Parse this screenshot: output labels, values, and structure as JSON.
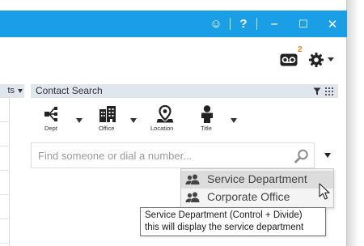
{
  "titlebar": {
    "color": "#1a9ee6",
    "buttons": [
      {
        "name": "feedback-smiley-icon",
        "glyph": "☺"
      },
      {
        "name": "help-icon",
        "glyph": "?"
      },
      {
        "name": "minimize-icon",
        "glyph": "–"
      },
      {
        "name": "maximize-icon",
        "glyph": "☐"
      },
      {
        "name": "close-icon",
        "glyph": "✕"
      }
    ]
  },
  "toolbar": {
    "voicemail_count": "2",
    "voicemail_badge_color": "#e8801a"
  },
  "left_panel": {
    "header_fragment": "ts"
  },
  "contact_search": {
    "title": "Contact Search",
    "filters": [
      {
        "label": "Dept",
        "icon": "org-chart-icon"
      },
      {
        "label": "Office",
        "icon": "building-icon"
      },
      {
        "label": "Location",
        "icon": "location-pin-icon"
      },
      {
        "label": "Title",
        "icon": "person-icon"
      }
    ],
    "search_placeholder": "Find someone or dial a number..."
  },
  "dropdown": {
    "items": [
      {
        "label": "Service Department",
        "selected": true,
        "icon": "group-icon"
      },
      {
        "label": "Corporate Office",
        "selected": false,
        "icon": "group-icon"
      }
    ]
  },
  "tooltip": {
    "line1": "Service Department (Control + Divide)",
    "line2": "this will display the service department"
  }
}
